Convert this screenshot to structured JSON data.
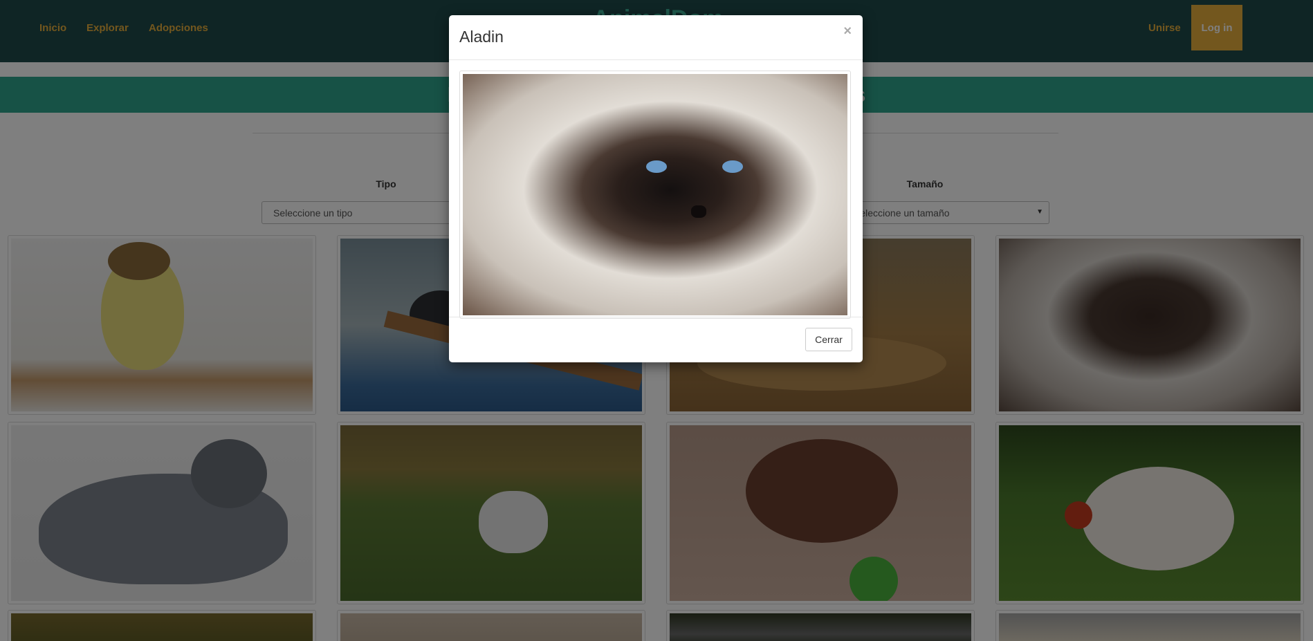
{
  "nav": {
    "links": [
      "Inicio",
      "Explorar",
      "Adopciones"
    ],
    "brand": "AnimalDom",
    "join": "Unirse",
    "login": "Log in"
  },
  "banner": {
    "title": "Explora nuestra comunidad de mascotas"
  },
  "filters": {
    "tipo_label": "Tipo",
    "tipo_placeholder": "Seleccione un tipo",
    "tamano_label": "Tamaño",
    "tamano_placeholder": "Seleccione un tamaño"
  },
  "pets": [
    {
      "name": "canary",
      "color": "#d9c47a"
    },
    {
      "name": "finch",
      "color": "#5a7a8c"
    },
    {
      "name": "bengal-cat",
      "color": "#a57b45"
    },
    {
      "name": "siamese-cat",
      "color": "#7a6b63"
    },
    {
      "name": "persian-cat",
      "color": "#8a8f95"
    },
    {
      "name": "white-dog",
      "color": "#5f7a3e"
    },
    {
      "name": "chocolate-puppy",
      "color": "#8a5b45"
    },
    {
      "name": "beagle",
      "color": "#4f7a2c"
    }
  ],
  "modal": {
    "title": "Aladin",
    "close_icon": "×",
    "close_button": "Cerrar"
  }
}
